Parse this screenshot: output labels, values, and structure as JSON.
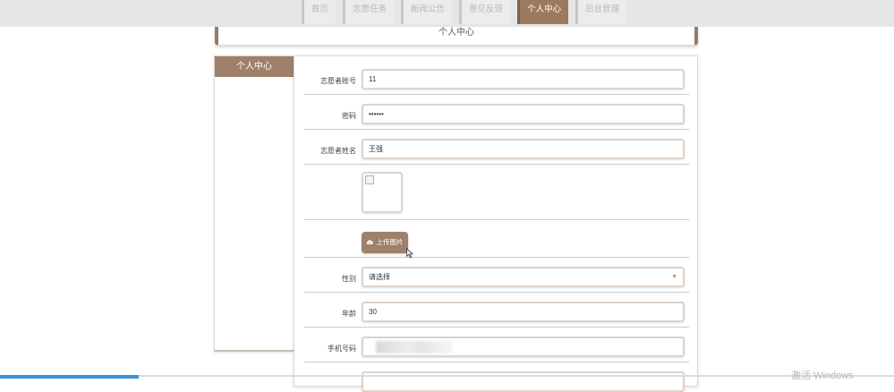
{
  "nav": {
    "items": [
      {
        "label": "首页"
      },
      {
        "label": "志愿任务"
      },
      {
        "label": "新闻公告"
      },
      {
        "label": "意见反馈"
      },
      {
        "label": "个人中心",
        "active": true
      },
      {
        "label": "后台管理"
      }
    ]
  },
  "header": {
    "title": "个人中心"
  },
  "sidebar": {
    "title": "个人中心"
  },
  "form": {
    "account_label": "志愿者账号",
    "account_value": "11",
    "password_label": "密码",
    "password_value": "••••••",
    "name_label": "志愿者姓名",
    "name_value": "王强",
    "upload_label": "上传图片",
    "gender_label": "性别",
    "gender_value": "请选择",
    "age_label": "年龄",
    "age_value": "30",
    "phone_label": "手机号码"
  },
  "icons": {
    "upload": "cloud-upload-icon",
    "select": "chevron-down-icon",
    "cursor": "mouse-pointer-icon"
  },
  "watermark": "激活 Windows",
  "colors": {
    "accent": "#9c7a60",
    "accent_light": "#a0806a",
    "topbar": "#e6e6e6",
    "progress": "#3d8fd6"
  }
}
